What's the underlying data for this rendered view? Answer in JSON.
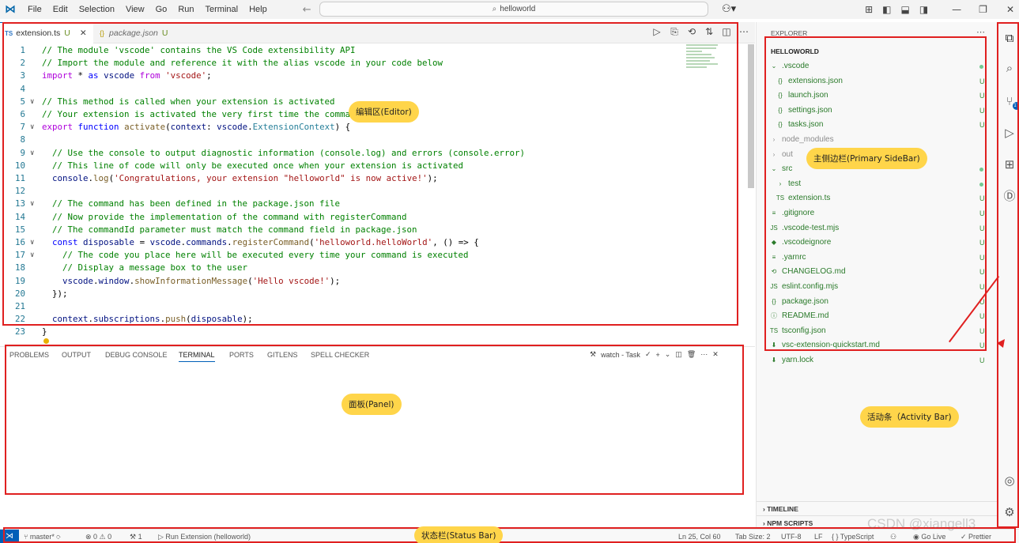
{
  "titlebar": {
    "menu": [
      "File",
      "Edit",
      "Selection",
      "View",
      "Go",
      "Run",
      "Terminal",
      "Help"
    ],
    "search_text": "helloworld"
  },
  "tabs": [
    {
      "icon": "TS",
      "label": "extension.ts",
      "status": "U"
    },
    {
      "icon": "{}",
      "label": "package.json",
      "status": "U"
    }
  ],
  "code_lines": [
    {
      "n": "1",
      "text": "// The module 'vscode' contains the VS Code extensibility API"
    },
    {
      "n": "2",
      "text": "// Import the module and reference it with the alias vscode in your code below"
    },
    {
      "n": "3",
      "text": "import * as vscode from 'vscode';"
    },
    {
      "n": "4",
      "text": ""
    },
    {
      "n": "5",
      "text": "// This method is called when your extension is activated"
    },
    {
      "n": "6",
      "text": "// Your extension is activated the very first time the comma"
    },
    {
      "n": "7",
      "text": "export function activate(context: vscode.ExtensionContext) {"
    },
    {
      "n": "8",
      "text": ""
    },
    {
      "n": "9",
      "text": "  // Use the console to output diagnostic information (console.log) and errors (console.error)"
    },
    {
      "n": "10",
      "text": "  // This line of code will only be executed once when your extension is activated"
    },
    {
      "n": "11",
      "text": "  console.log('Congratulations, your extension \"helloworld\" is now active!');"
    },
    {
      "n": "12",
      "text": ""
    },
    {
      "n": "13",
      "text": "  // The command has been defined in the package.json file"
    },
    {
      "n": "14",
      "text": "  // Now provide the implementation of the command with registerCommand"
    },
    {
      "n": "15",
      "text": "  // The commandId parameter must match the command field in package.json"
    },
    {
      "n": "16",
      "text": "  const disposable = vscode.commands.registerCommand('helloworld.helloWorld', () => {"
    },
    {
      "n": "17",
      "text": "    // The code you place here will be executed every time your command is executed"
    },
    {
      "n": "18",
      "text": "    // Display a message box to the user"
    },
    {
      "n": "19",
      "text": "    vscode.window.showInformationMessage('Hello vscode!');"
    },
    {
      "n": "20",
      "text": "  });"
    },
    {
      "n": "21",
      "text": ""
    },
    {
      "n": "22",
      "text": "  context.subscriptions.push(disposable);"
    },
    {
      "n": "23",
      "text": "}"
    }
  ],
  "panel": {
    "tabs": [
      "PROBLEMS",
      "OUTPUT",
      "DEBUG CONSOLE",
      "TERMINAL",
      "PORTS",
      "GITLENS",
      "SPELL CHECKER"
    ],
    "active_tab": "TERMINAL",
    "task_label": "watch - Task"
  },
  "explorer": {
    "title": "EXPLORER",
    "root": "HELLOWORLD",
    "items": [
      {
        "label": ".vscode",
        "status": "dot"
      },
      {
        "label": "extensions.json",
        "status": "U"
      },
      {
        "label": "launch.json",
        "status": "U"
      },
      {
        "label": "settings.json",
        "status": "U"
      },
      {
        "label": "tasks.json",
        "status": "U"
      },
      {
        "label": "node_modules",
        "status": ""
      },
      {
        "label": "out",
        "status": ""
      },
      {
        "label": "src",
        "status": "dot"
      },
      {
        "label": "test",
        "status": "dot"
      },
      {
        "label": "extension.ts",
        "status": "U"
      },
      {
        "label": ".gitignore",
        "status": "U"
      },
      {
        "label": ".vscode-test.mjs",
        "status": "U"
      },
      {
        "label": ".vscodeignore",
        "status": "U"
      },
      {
        "label": ".yarnrc",
        "status": "U"
      },
      {
        "label": "CHANGELOG.md",
        "status": "U"
      },
      {
        "label": "eslint.config.mjs",
        "status": "U"
      },
      {
        "label": "package.json",
        "status": "U"
      },
      {
        "label": "README.md",
        "status": "U"
      },
      {
        "label": "tsconfig.json",
        "status": "U"
      },
      {
        "label": "vsc-extension-quickstart.md",
        "status": "U"
      },
      {
        "label": "yarn.lock",
        "status": "U"
      }
    ],
    "sections": [
      "TIMELINE",
      "NPM SCRIPTS"
    ]
  },
  "statusbar": {
    "branch": "master*",
    "problems": "⊗ 0 ⚠ 0",
    "ports": "1",
    "run": "Run Extension (helloworld)",
    "position": "Ln 25, Col 60",
    "tab_size": "Tab Size: 2",
    "encoding": "UTF-8",
    "eol": "LF",
    "language": "{ } TypeScript",
    "golive": "Go Live",
    "prettier": "✓ Prettier"
  },
  "annotations": {
    "editor": "编辑区(Editor)",
    "sidebar": "主侧边栏(Primary SideBar)",
    "panel": "面板(Panel)",
    "activity": "活动条（Activity Bar)",
    "status": "状态栏(Status Bar)",
    "watermark": "CSDN @xiangell3"
  },
  "colors": {
    "accent": "#005fb8",
    "annotation_box": "#e02020",
    "callout": "#ffd54a"
  }
}
